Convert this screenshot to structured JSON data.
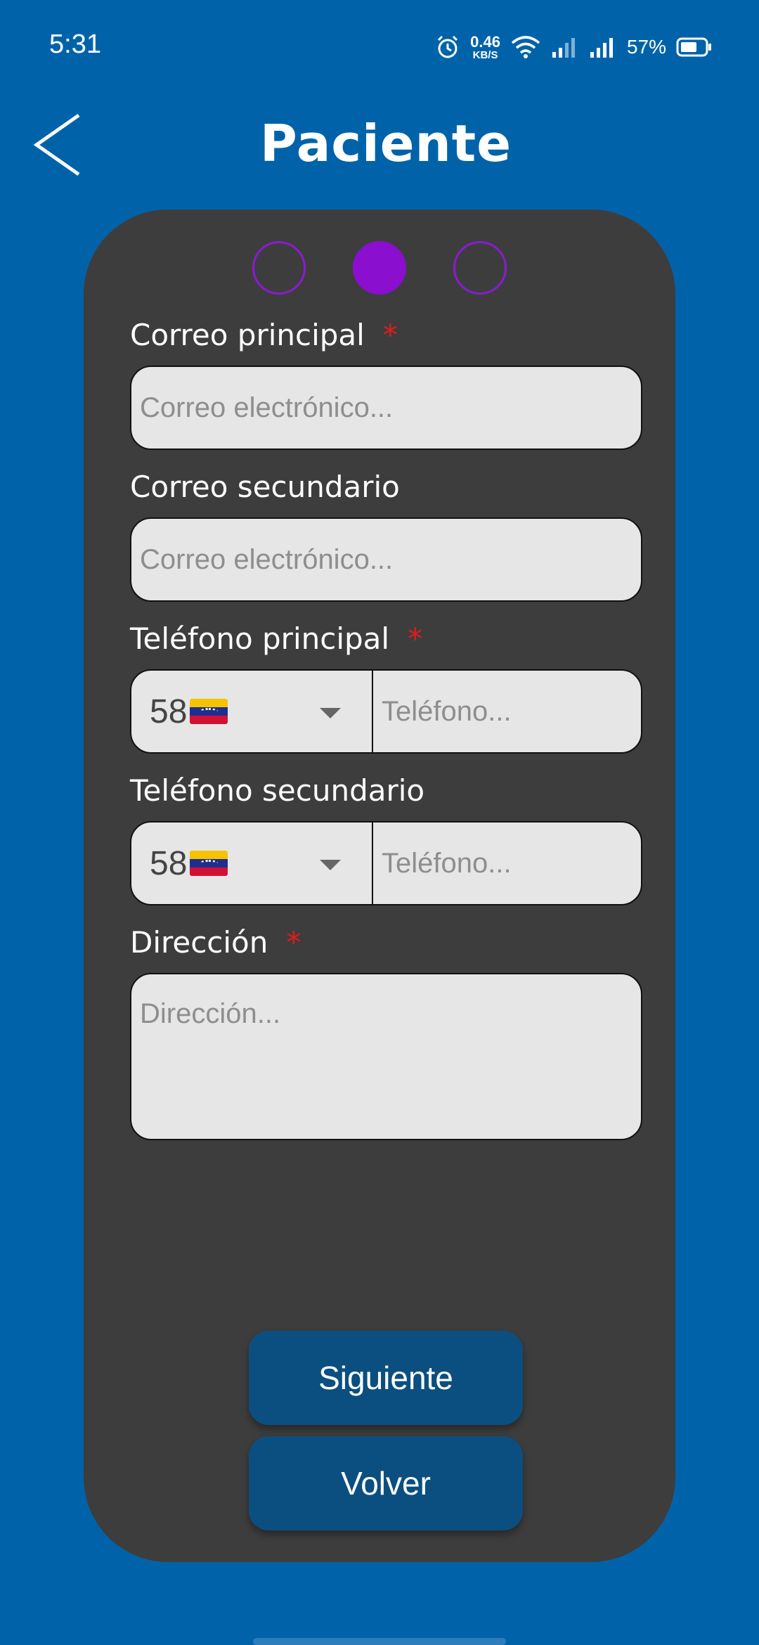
{
  "status_bar": {
    "time": "5:31",
    "net_speed_value": "0.46",
    "net_speed_unit": "KB/S",
    "battery_percent": "57%",
    "icons": [
      "alarm-icon",
      "wifi-icon",
      "signal-icon",
      "signal-icon",
      "battery-icon"
    ]
  },
  "header": {
    "title": "Paciente",
    "back_icon": "chevron-left-icon"
  },
  "stepper": {
    "steps": 3,
    "current": 2,
    "accent": "#8A0FCF"
  },
  "form": {
    "primary_email": {
      "label": "Correo principal",
      "required_mark": "*",
      "placeholder": "Correo electrónico...",
      "value": ""
    },
    "secondary_email": {
      "label": "Correo secundario",
      "placeholder": "Correo electrónico...",
      "value": ""
    },
    "primary_phone": {
      "label": "Teléfono principal",
      "required_mark": "*",
      "country_code": "58",
      "flag": "venezuela-flag-icon",
      "placeholder": "Teléfono...",
      "value": ""
    },
    "secondary_phone": {
      "label": "Teléfono secundario",
      "country_code": "58",
      "flag": "venezuela-flag-icon",
      "placeholder": "Teléfono...",
      "value": ""
    },
    "address": {
      "label": "Dirección",
      "required_mark": "*",
      "placeholder": "Dirección...",
      "value": ""
    }
  },
  "buttons": {
    "next": "Siguiente",
    "back": "Volver"
  },
  "colors": {
    "background": "#0063AA",
    "card": "#3D3D3D",
    "field": "#E6E6E6",
    "button": "#0B4F80",
    "required": "#E01B1B"
  }
}
